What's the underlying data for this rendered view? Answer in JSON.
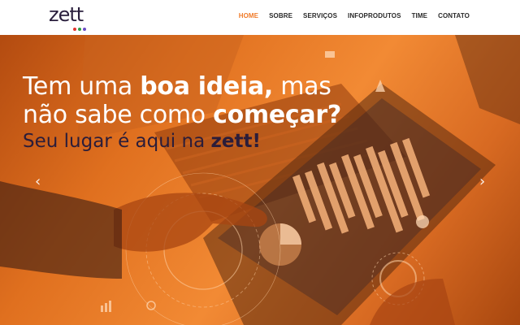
{
  "brand": {
    "logo_text": "zett",
    "dot_colors": [
      "#e2342d",
      "#2f9e44",
      "#6a4bc4"
    ]
  },
  "nav": {
    "items": [
      {
        "label": "HOME",
        "active": true
      },
      {
        "label": "SOBRE",
        "active": false
      },
      {
        "label": "SERVIÇOS",
        "active": false
      },
      {
        "label": "INFOPRODUTOS",
        "active": false
      },
      {
        "label": "TIME",
        "active": false
      },
      {
        "label": "CONTATO",
        "active": false
      }
    ]
  },
  "hero": {
    "headline_1a": "Tem uma ",
    "headline_1b": "boa ideia,",
    "headline_1c": " mas",
    "headline_2a": "não sabe como ",
    "headline_2b": "começar?",
    "subline_a": "Seu lugar é aqui na ",
    "subline_b": "zett!",
    "prev_icon": "‹",
    "next_icon": "›"
  },
  "colors": {
    "accent": "#f07b2a",
    "nav_text": "#2a2a2a",
    "brand_dark": "#2b1d3a",
    "hero_orange": "#e0701f"
  }
}
